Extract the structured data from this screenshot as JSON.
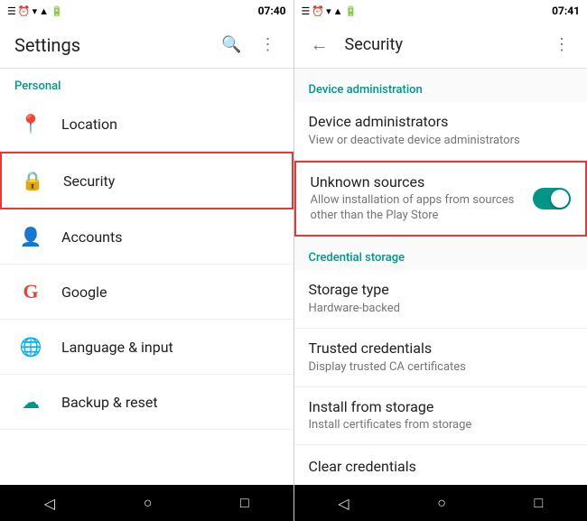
{
  "leftPanel": {
    "statusBar": {
      "icons": [
        "☰",
        "⏰",
        "▼",
        "📶",
        "🔋"
      ],
      "time": "07:40"
    },
    "toolbar": {
      "title": "Settings",
      "searchIcon": "🔍",
      "moreIcon": "⋮"
    },
    "sections": [
      {
        "name": "Personal",
        "items": [
          {
            "icon": "📍",
            "label": "Location"
          },
          {
            "icon": "🔒",
            "label": "Security",
            "selected": true
          },
          {
            "icon": "👤",
            "label": "Accounts"
          },
          {
            "icon": "G",
            "label": "Google"
          },
          {
            "icon": "🌐",
            "label": "Language & input"
          },
          {
            "icon": "☁",
            "label": "Backup & reset"
          }
        ]
      }
    ],
    "navBar": {
      "backBtn": "◁",
      "homeBtn": "○",
      "recentsBtn": "□"
    }
  },
  "rightPanel": {
    "statusBar": {
      "time": "07:41"
    },
    "toolbar": {
      "backIcon": "←",
      "title": "Security",
      "moreIcon": "⋮"
    },
    "sections": [
      {
        "name": "Device administration",
        "items": [
          {
            "title": "Device administrators",
            "subtitle": "View or deactivate device administrators",
            "highlighted": false,
            "hasToggle": false
          },
          {
            "title": "Unknown sources",
            "subtitle": "Allow installation of apps from sources other than the Play Store",
            "highlighted": true,
            "hasToggle": true,
            "toggleOn": true
          }
        ]
      },
      {
        "name": "Credential storage",
        "items": [
          {
            "title": "Storage type",
            "subtitle": "Hardware-backed",
            "highlighted": false,
            "hasToggle": false
          },
          {
            "title": "Trusted credentials",
            "subtitle": "Display trusted CA certificates",
            "highlighted": false,
            "hasToggle": false
          },
          {
            "title": "Install from storage",
            "subtitle": "Install certificates from storage",
            "highlighted": false,
            "hasToggle": false
          },
          {
            "title": "Clear credentials",
            "subtitle": "",
            "highlighted": false,
            "hasToggle": false
          }
        ]
      }
    ],
    "navBar": {
      "backBtn": "◁",
      "homeBtn": "○",
      "recentsBtn": "□"
    }
  }
}
